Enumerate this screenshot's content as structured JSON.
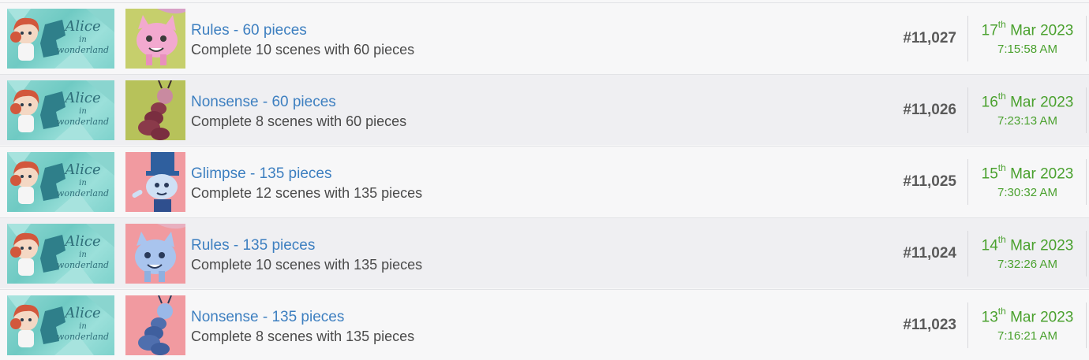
{
  "colors": {
    "title_link": "#3d7fc0",
    "date_green": "#4aa12e",
    "number_gray": "#5a5a5a"
  },
  "game": {
    "logo_text_line1": "Alice",
    "logo_text_line2": "in",
    "logo_text_line3": "wonderland"
  },
  "achievements": [
    {
      "title": "Rules - 60 pieces",
      "description": "Complete 10 scenes with 60 pieces",
      "number": "#11,027",
      "day": "17",
      "suffix": "th",
      "month_year": "Mar 2023",
      "time": "7:15:58 AM",
      "icon": "pink-cheshire-cat-icon"
    },
    {
      "title": "Nonsense - 60 pieces",
      "description": "Complete 8 scenes with 60 pieces",
      "number": "#11,026",
      "day": "16",
      "suffix": "th",
      "month_year": "Mar 2023",
      "time": "7:23:13 AM",
      "icon": "caterpillar-olive-icon"
    },
    {
      "title": "Glimpse - 135 pieces",
      "description": "Complete 12 scenes with 135 pieces",
      "number": "#11,025",
      "day": "15",
      "suffix": "th",
      "month_year": "Mar 2023",
      "time": "7:30:32 AM",
      "icon": "white-rabbit-top-hat-icon"
    },
    {
      "title": "Rules - 135 pieces",
      "description": "Complete 10 scenes with 135 pieces",
      "number": "#11,024",
      "day": "14",
      "suffix": "th",
      "month_year": "Mar 2023",
      "time": "7:32:26 AM",
      "icon": "blue-cheshire-cat-icon"
    },
    {
      "title": "Nonsense - 135 pieces",
      "description": "Complete 8 scenes with 135 pieces",
      "number": "#11,023",
      "day": "13",
      "suffix": "th",
      "month_year": "Mar 2023",
      "time": "7:16:21 AM",
      "icon": "caterpillar-blue-icon"
    }
  ]
}
